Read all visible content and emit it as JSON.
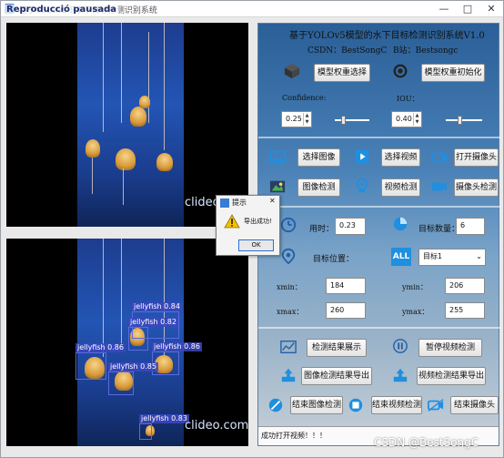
{
  "window": {
    "title": "基于YOLOv5下水下目标检测识别系统",
    "overlay_label": "Reproducció pausada",
    "controls": [
      "—",
      "□",
      "✕"
    ]
  },
  "video": {
    "watermark_top": "clideo.com",
    "watermark_bottom": "clideo.com",
    "detections": [
      {
        "label": "jellyfish 0.84"
      },
      {
        "label": "jellyfish 0.82"
      },
      {
        "label": "jellyfish 0.86"
      },
      {
        "label": "jellyfish 0.86"
      },
      {
        "label": "jellyfish 0.85"
      },
      {
        "label": "jellyfish 0.83"
      }
    ]
  },
  "panel": {
    "title": "基于YOLOv5模型的水下目标检测识别系统V1.0",
    "csdn": "CSDN：BestSongC",
    "bilibili": "B站：Bestsongc",
    "btn_select_weights": "模型权重选择",
    "btn_init_weights": "模型权重初始化",
    "confidence_label": "Confidence:",
    "iou_label": "IOU：",
    "confidence_value": "0.25",
    "iou_value": "0.40",
    "confidence_level": 0.25,
    "iou_level": 0.4,
    "btn_select_image": "选择图像",
    "btn_select_video": "选择视频",
    "btn_open_camera": "打开摄像头",
    "btn_image_detect": "图像检测",
    "btn_video_detect": "视频检测",
    "btn_camera_detect": "摄像头检测",
    "time_label": "用时：",
    "time_value": "0.23",
    "count_label": "目标数量：",
    "count_value": "6",
    "position_label": "目标位置：",
    "all_icon_text": "ALL",
    "target_select": "目标1",
    "xmin_label": "xmin：",
    "xmin_value": "184",
    "ymin_label": "ymin：",
    "ymin_value": "206",
    "xmax_label": "xmax：",
    "xmax_value": "260",
    "ymax_label": "ymax：",
    "ymax_value": "255",
    "btn_show_results": "检测结果展示",
    "btn_pause_video": "暂停视频检测",
    "btn_export_image": "图像检测结果导出",
    "btn_export_video": "视频检测结果导出",
    "btn_end_image": "结束图像检测",
    "btn_end_video": "结束视频检测",
    "btn_end_camera": "结束摄像头",
    "status": "成功打开视频！！！"
  },
  "dialog": {
    "title": "提示",
    "message": "导出成功!",
    "ok": "OK",
    "close": "✕"
  },
  "watermark": "CSDN @BestSongC",
  "colors": {
    "panel_top": "#2a5f97",
    "video_blue": "#2355b4",
    "bbox": "#5b6be0",
    "icon_blue": "#1f8fe0"
  }
}
